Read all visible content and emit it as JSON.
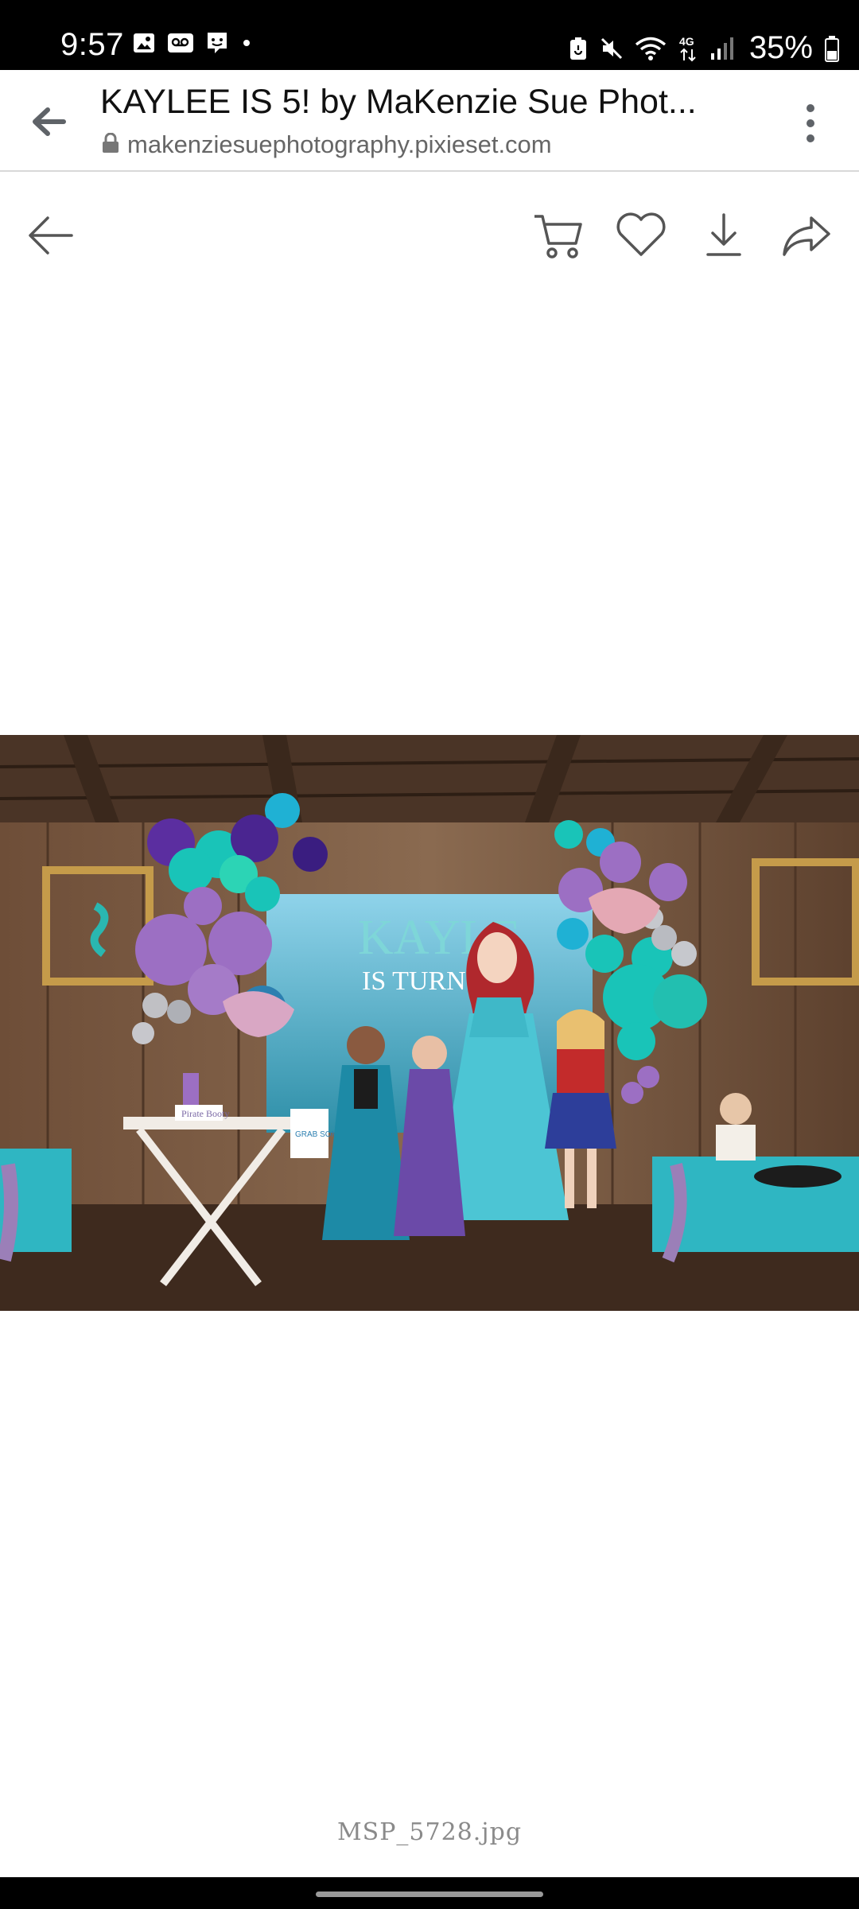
{
  "status_bar": {
    "time": "9:57",
    "left_icons": [
      "image-icon",
      "voicemail-icon",
      "messenger-icon",
      "dot-icon"
    ],
    "right_icons": [
      "battery-saver-icon",
      "mute-icon",
      "wifi-icon",
      "4g-icon",
      "signal-icon",
      "battery-icon"
    ],
    "network": "4G",
    "battery_percent": "35%"
  },
  "address_bar": {
    "title": "KAYLEE IS 5! by MaKenzie Sue Phot...",
    "url": "makenziesuephotography.pixieset.com",
    "back_icon": "arrow-back-icon",
    "lock_icon": "lock-icon",
    "menu_icon": "more-vert-icon"
  },
  "viewer_toolbar": {
    "back_icon": "arrow-left-icon",
    "actions": [
      "cart-icon",
      "heart-icon",
      "download-icon",
      "share-icon"
    ]
  },
  "photo": {
    "banner_line1": "KAYLE",
    "banner_line2": "IS TURN",
    "sign_text": "Pirate Booty",
    "prop_sign": "GRAB SOME PROPS"
  },
  "filename": "MSP_5728.jpg",
  "colors": {
    "status_bar_bg": "#000000",
    "icon_gray": "#5f6368",
    "balloon_teal": "#19c4b8",
    "balloon_purple": "#9c6fc3",
    "tablecloth": "#2fb6c2",
    "wood": "#6b4a33"
  }
}
